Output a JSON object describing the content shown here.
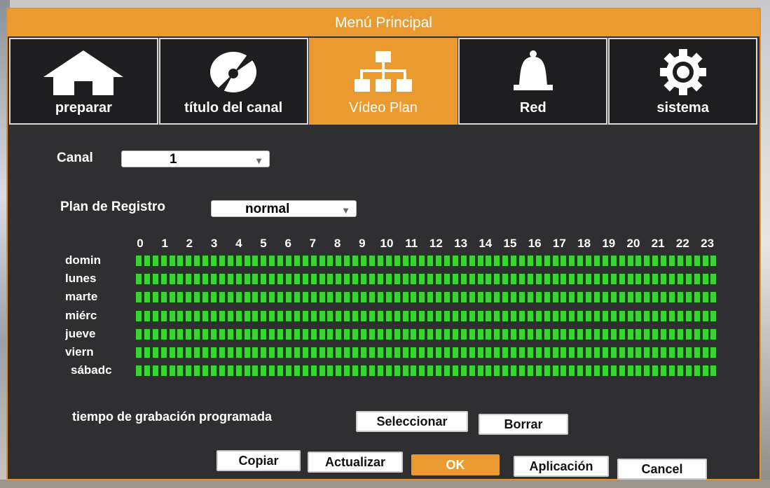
{
  "dialog": {
    "title": "Menú Principal"
  },
  "tabs": [
    {
      "label": "preparar",
      "icon": "home-icon"
    },
    {
      "label": "título del canal",
      "icon": "disc-icon"
    },
    {
      "label": "Vídeo Plan",
      "icon": "network-icon",
      "active": true
    },
    {
      "label": "Red",
      "icon": "bell-icon"
    },
    {
      "label": "sistema",
      "icon": "gear-icon"
    }
  ],
  "channel": {
    "label": "Canal",
    "value": "1"
  },
  "record_plan": {
    "label": "Plan de Registro",
    "value": "normal"
  },
  "schedule": {
    "hours": [
      "0",
      "1",
      "2",
      "3",
      "4",
      "5",
      "6",
      "7",
      "8",
      "9",
      "10",
      "11",
      "12",
      "13",
      "14",
      "15",
      "16",
      "17",
      "18",
      "19",
      "20",
      "21",
      "22",
      "23"
    ],
    "days": [
      "domin",
      "lunes",
      "marte",
      "miérc",
      "jueve",
      "viern",
      "sábadc"
    ],
    "cell_color": "#35d62d",
    "cells_per_row": 70,
    "all_selected": true
  },
  "scheduled_time": {
    "label": "tiempo de grabación programada",
    "select_button": "Seleccionar",
    "clear_button": "Borrar"
  },
  "footer": {
    "copy": "Copiar",
    "update": "Actualizar",
    "ok": "OK",
    "apply": "Aplicación",
    "cancel": "Cancel"
  },
  "colors": {
    "accent": "#eb9a30",
    "panel": "#2f2f31",
    "tab_bg": "#1e1e20"
  }
}
